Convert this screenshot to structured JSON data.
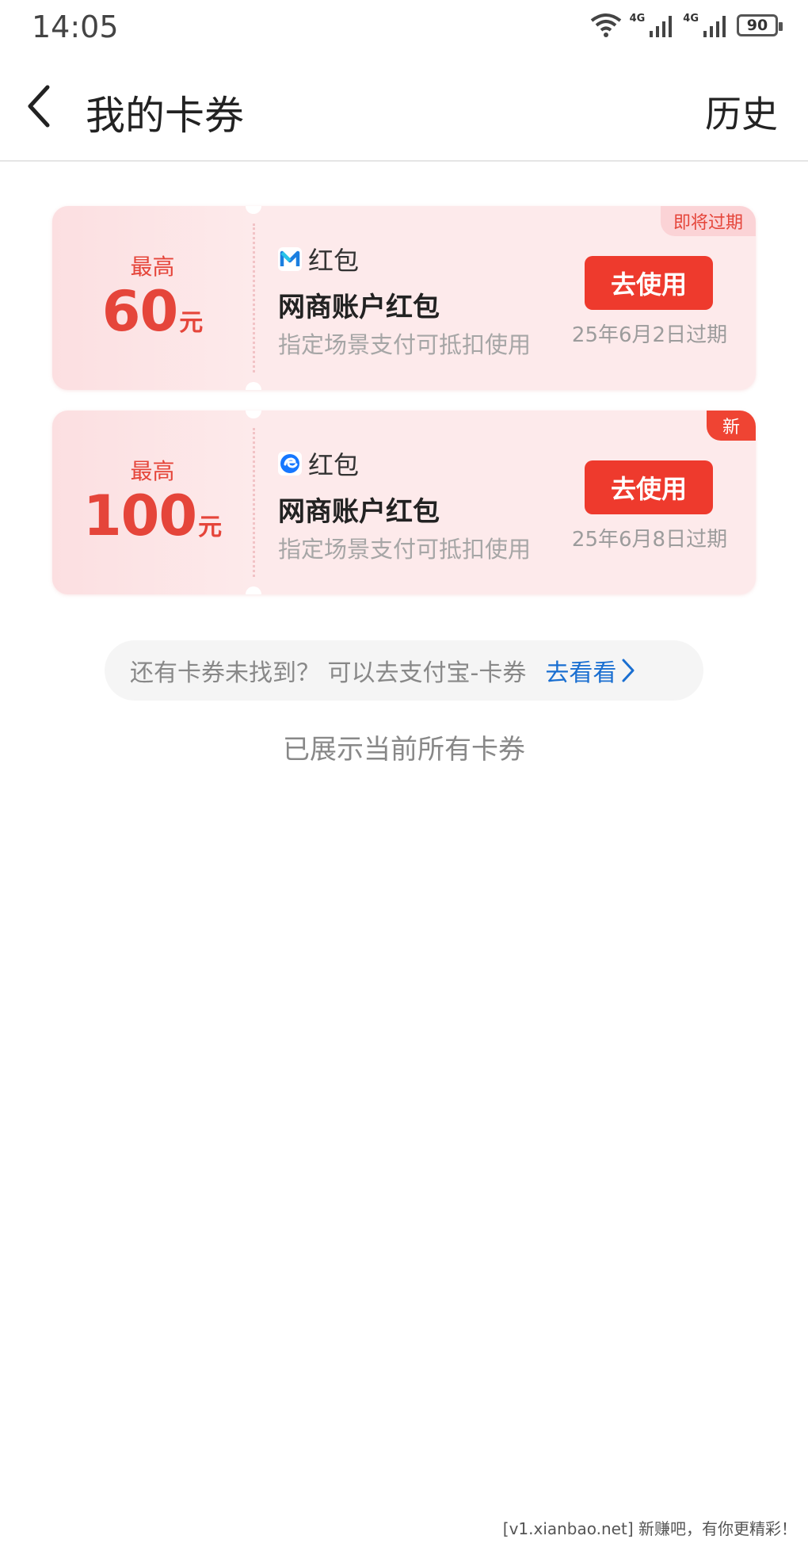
{
  "status_bar": {
    "time": "14:05",
    "network_1": "4G",
    "network_2": "4G",
    "battery": "90"
  },
  "nav": {
    "title": "我的卡券",
    "history_label": "历史"
  },
  "coupons": [
    {
      "amount_label": "最高",
      "amount": "60",
      "unit": "元",
      "brand_icon": "mybank-icon",
      "brand": "红包",
      "name": "网商账户红包",
      "description": "指定场景支付可抵扣使用",
      "button": "去使用",
      "expire": "25年6月2日过期",
      "tag": "即将过期"
    },
    {
      "amount_label": "最高",
      "amount": "100",
      "unit": "元",
      "brand_icon": "alipay-icon",
      "brand": "红包",
      "name": "网商账户红包",
      "description": "指定场景支付可抵扣使用",
      "button": "去使用",
      "expire": "25年6月8日过期",
      "tag": "新"
    }
  ],
  "more": {
    "text": "还有卡券未找到？ 可以去支付宝-卡券",
    "link": "去看看"
  },
  "end_text": "已展示当前所有卡券",
  "watermark": "[v1.xianbao.net] 新赚吧，有你更精彩！",
  "colors": {
    "accent": "#ee3a2d",
    "amount": "#e5453a",
    "link": "#1a6fd1",
    "card_bg": "#fdeaeb"
  }
}
